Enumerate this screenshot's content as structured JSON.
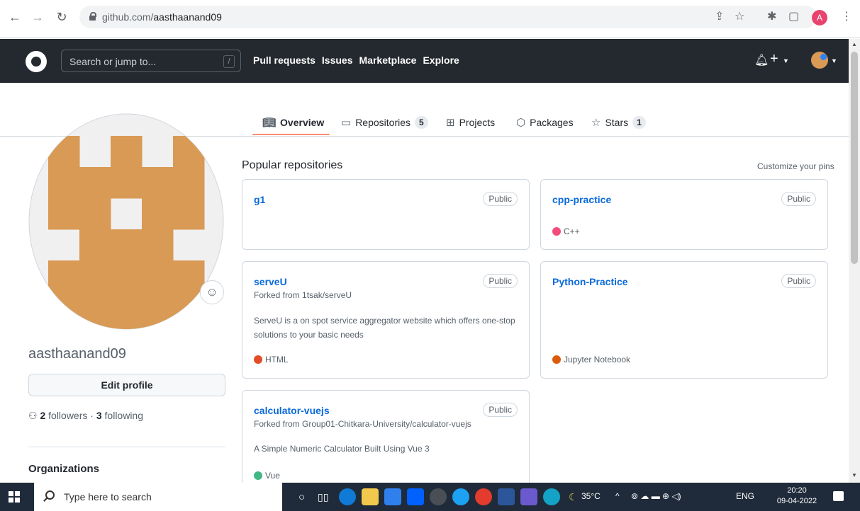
{
  "browser": {
    "url_host": "github.com/",
    "url_path": "aasthaanand09",
    "profile_initial": "A"
  },
  "header": {
    "search_placeholder": "Search or jump to...",
    "slash_key": "/",
    "nav": [
      "Pull requests",
      "Issues",
      "Marketplace",
      "Explore"
    ]
  },
  "tabs": [
    {
      "label": "Overview",
      "icon": "book-icon",
      "count": ""
    },
    {
      "label": "Repositories",
      "icon": "repo-icon",
      "count": "5"
    },
    {
      "label": "Projects",
      "icon": "project-icon",
      "count": ""
    },
    {
      "label": "Packages",
      "icon": "package-icon",
      "count": ""
    },
    {
      "label": "Stars",
      "icon": "star-icon",
      "count": "1"
    }
  ],
  "profile": {
    "username": "aasthaanand09",
    "edit_label": "Edit profile",
    "followers_count": "2",
    "followers_label": "followers",
    "separator": "·",
    "following_count": "3",
    "following_label": "following",
    "organizations_title": "Organizations",
    "avatar_color": "#d99a55"
  },
  "popular": {
    "title": "Popular repositories",
    "customize": "Customize your pins",
    "repos": [
      {
        "name": "g1",
        "visibility": "Public",
        "forked": "",
        "description": "",
        "language": "",
        "language_color": ""
      },
      {
        "name": "cpp-practice",
        "visibility": "Public",
        "forked": "",
        "description": "",
        "language": "C++",
        "language_color": "#f34b7d"
      },
      {
        "name": "serveU",
        "visibility": "Public",
        "forked": "Forked from 1tsak/serveU",
        "description": "ServeU is a on spot service aggregator website which offers one-stop solutions to your basic needs",
        "language": "HTML",
        "language_color": "#e34c26"
      },
      {
        "name": "Python-Practice",
        "visibility": "Public",
        "forked": "",
        "description": "",
        "language": "Jupyter Notebook",
        "language_color": "#da5b0b"
      },
      {
        "name": "calculator-vuejs",
        "visibility": "Public",
        "forked": "Forked from Group01-Chitkara-University/calculator-vuejs",
        "description": "A Simple Numeric Calculator Built Using Vue 3",
        "language": "Vue",
        "language_color": "#41b883"
      }
    ]
  },
  "taskbar": {
    "search_placeholder": "Type here to search",
    "weather": "35°C",
    "language": "ENG",
    "time": "20:20",
    "date": "09-04-2022"
  }
}
